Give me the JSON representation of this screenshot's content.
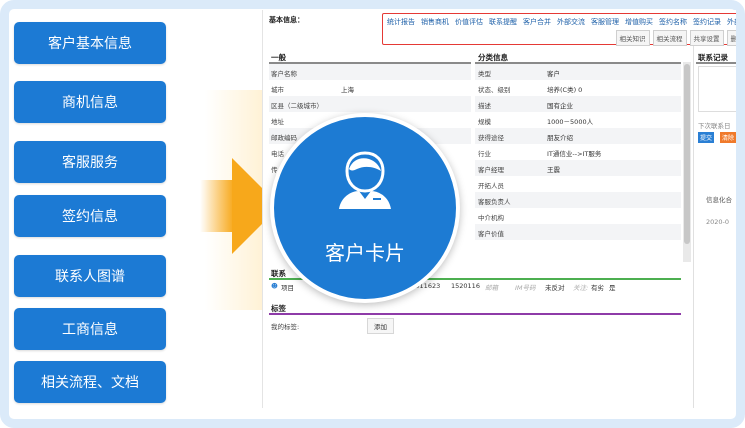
{
  "menu": {
    "items": [
      "客户基本信息",
      "商机信息",
      "客服服务",
      "签约信息",
      "联系人图谱",
      "工商信息",
      "相关流程、文档"
    ]
  },
  "screen": {
    "base_info_label": "基本信息：",
    "nav_links": [
      "统计报告",
      "销售商机",
      "价值评估",
      "联系提醒",
      "客户合并",
      "外部交流",
      "客服管理",
      "增值购买",
      "签约名称",
      "签约记录",
      "外部用户"
    ],
    "sub_buttons": [
      "相关知识",
      "相关流程",
      "共享设置",
      "删"
    ],
    "general": {
      "title": "一般",
      "rows": [
        {
          "label": "客户名称",
          "value": ""
        },
        {
          "label": "城市",
          "value": "上海"
        },
        {
          "label": "区县（二级城市）",
          "value": ""
        },
        {
          "label": "地址",
          "value": ""
        },
        {
          "label": "邮政编码",
          "value": ""
        },
        {
          "label": "电话",
          "value": ""
        },
        {
          "label": "传",
          "value": ""
        }
      ]
    },
    "category": {
      "title": "分类信息",
      "rows": [
        {
          "label": "类型",
          "value": "客户"
        },
        {
          "label": "状态、级别",
          "value": "培养(C类)    0"
        },
        {
          "label": "描述",
          "value": "国有企业"
        },
        {
          "label": "规模",
          "value": "1000－5000人"
        },
        {
          "label": "获得途径",
          "value": "朋友介绍"
        },
        {
          "label": "行业",
          "value": "IT通信业-->IT服务"
        },
        {
          "label": "客户经理",
          "value": "王震"
        },
        {
          "label": "开拓人员",
          "value": ""
        },
        {
          "label": "客服负责人",
          "value": ""
        },
        {
          "label": "中介机构",
          "value": ""
        },
        {
          "label": "客户价值",
          "value": ""
        }
      ]
    },
    "contact_log": {
      "title": "联系记录",
      "next_contact": "下次联系日",
      "submit": "提交",
      "cancel": "清除",
      "info_text": "信息化合",
      "date": "2020-0"
    },
    "contact": {
      "title": "联系",
      "project": "项目",
      "phone1": "152011623",
      "phone2": "1520116",
      "email_label": "邮箱",
      "im_label": "IM号码",
      "status": "未反对",
      "attention_label": "关注:",
      "attention_value": "有劣",
      "yes": "是"
    },
    "tags": {
      "title": "标签",
      "label": "我的标签:",
      "add": "添加"
    }
  },
  "badge": {
    "title": "客户卡片"
  },
  "colors": {
    "menu_blue": "#1c7ad4",
    "arrow_orange": "#f7a81b",
    "frame_blue": "#dbeaf9",
    "nav_red": "#e53935"
  }
}
